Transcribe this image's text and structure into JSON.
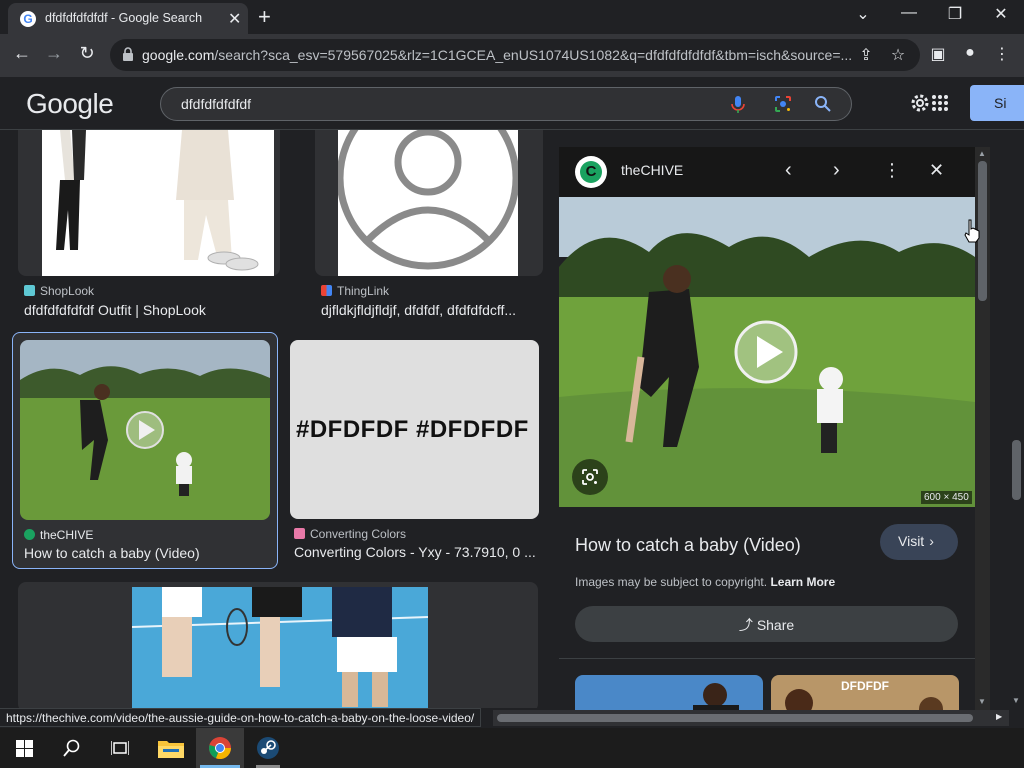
{
  "browser": {
    "tab_title": "dfdfdfdfdfdf - Google Search",
    "url_host": "google.com",
    "url_rest": "/search?sca_esv=579567025&rlz=1C1GCEA_enUS1074US1082&q=dfdfdfdfdfdf&tbm=isch&source=...",
    "status_url": "https://thechive.com/video/the-aussie-guide-on-how-to-catch-a-baby-on-the-loose-video/"
  },
  "google": {
    "logo": "Google",
    "query": "dfdfdfdfdfdf",
    "signin_label": "Si"
  },
  "results": [
    {
      "source": "ShopLook",
      "title": "dfdfdfdfdfdf Outfit | ShopLook",
      "fav_color": "#5ec8d4"
    },
    {
      "source": "ThingLink",
      "title": "djfldkjfldjfldjf, dfdfdf, dfdfdfdcff...",
      "fav_color": "#ea4335"
    },
    {
      "source": "theCHIVE",
      "title": "How to catch a baby (Video)",
      "fav_color": "#1aa260"
    },
    {
      "source": "Converting Colors",
      "title": "Converting Colors - Yxy - 73.7910, 0 ...",
      "fav_color": "#e879a8"
    }
  ],
  "thumb_text": "#DFDFDF #DFDFDF",
  "panel": {
    "source": "theCHIVE",
    "dimensions": "600 × 450",
    "title": "How to catch a baby (Video)",
    "visit_label": "Visit",
    "copyright_note": "Images may be subject to copyright.",
    "learn_more": "Learn More",
    "share_label": "Share",
    "related_text": "DFDFDF"
  },
  "colors": {
    "accent": "#8ab4f8",
    "panel_bg": "#202124",
    "grass": "#6a9a3a",
    "court": "#4aa8d8"
  }
}
